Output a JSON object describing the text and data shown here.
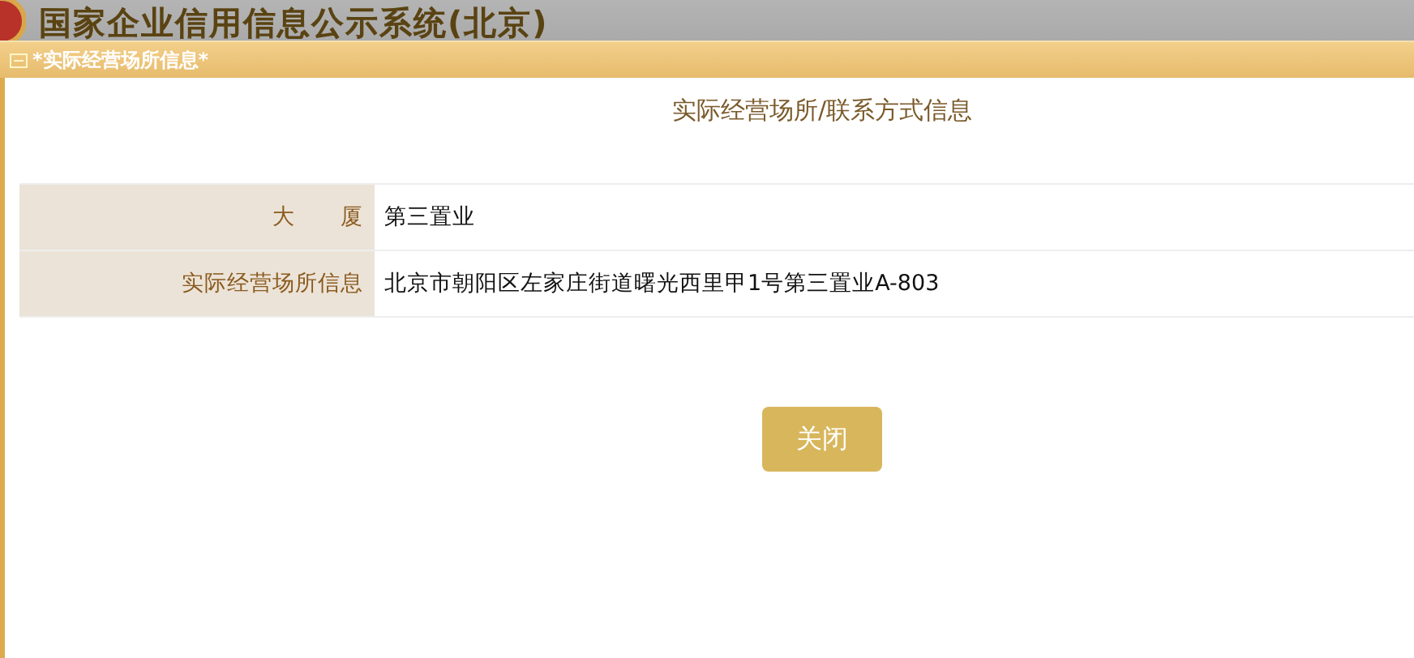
{
  "site_header": {
    "title": "国家企业信用信息公示系统(北京)"
  },
  "dialog": {
    "title": "*实际经营场所信息*",
    "heading": "实际经营场所/联系方式信息",
    "rows": [
      {
        "label": "大　　厦",
        "value": "第三置业"
      },
      {
        "label": "实际经营场所信息",
        "value": "北京市朝阳区左家庄街道曙光西里甲1号第三置业A-803"
      }
    ],
    "buttons": [
      "关闭"
    ]
  }
}
